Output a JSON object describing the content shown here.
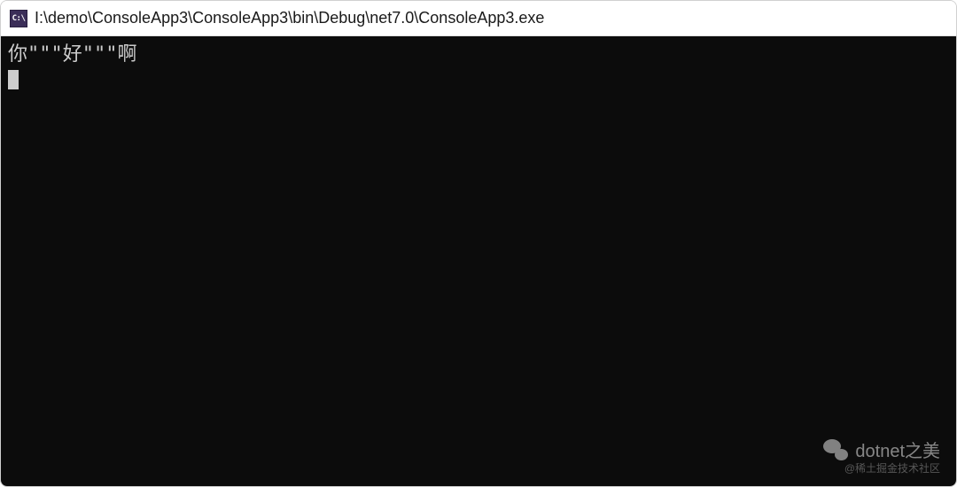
{
  "titlebar": {
    "icon_label": "C:\\",
    "path": "I:\\demo\\ConsoleApp3\\ConsoleApp3\\bin\\Debug\\net7.0\\ConsoleApp3.exe"
  },
  "console": {
    "output_line1": "你\"\"\"好\"\"\"啊"
  },
  "watermark": {
    "title": "dotnet之美",
    "subtitle": "@稀土掘金技术社区"
  }
}
